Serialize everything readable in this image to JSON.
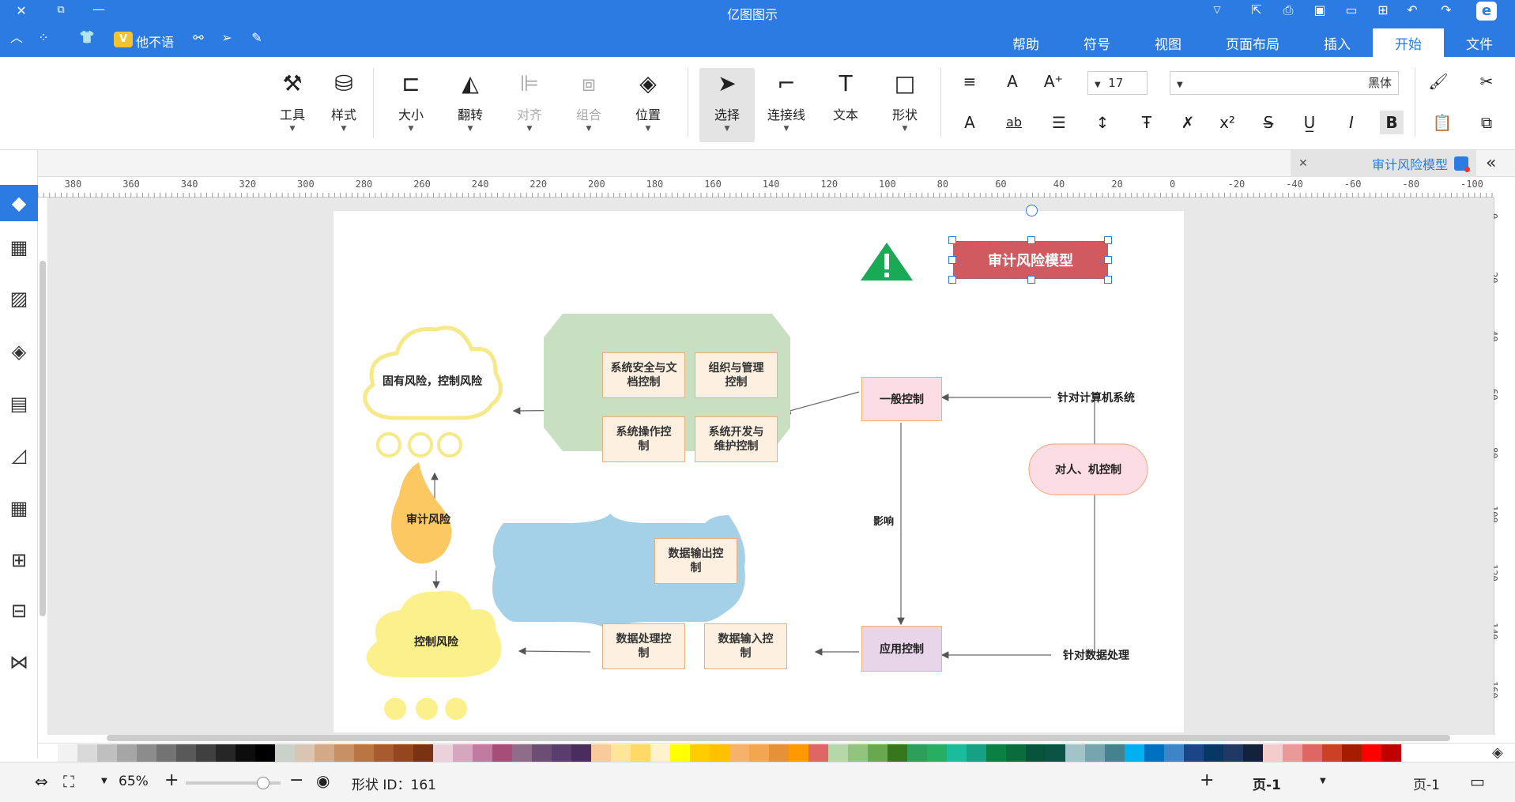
{
  "titlebar": {
    "title": "亿图图示"
  },
  "menubar": {
    "tabs": [
      {
        "label": "文件"
      },
      {
        "label": "开始"
      },
      {
        "label": "插入"
      },
      {
        "label": "页面布局"
      },
      {
        "label": "视图"
      },
      {
        "label": "符号"
      },
      {
        "label": "帮助"
      }
    ],
    "active_tab": "开始",
    "user": "他不语"
  },
  "ribbon": {
    "font_name": "黑体",
    "font_size": "17",
    "tools": {
      "shape": "形状",
      "text": "文本",
      "connector": "连接线",
      "select": "选择",
      "position": "位置",
      "group": "组合",
      "align": "对齐",
      "flip": "翻转",
      "size": "大小",
      "style": "样式",
      "tool": "工具"
    }
  },
  "doc_tab": {
    "title": "审计风险模型"
  },
  "ruler": {
    "h_ticks": [
      "-100",
      "-80",
      "-60",
      "-40",
      "-20",
      "0",
      "20",
      "40",
      "60",
      "80",
      "100",
      "120",
      "140",
      "160",
      "180",
      "200",
      "220",
      "240",
      "260",
      "280",
      "300",
      "320",
      "340",
      "360",
      "380"
    ],
    "v_ticks": [
      "0",
      "20",
      "40",
      "60",
      "80",
      "100",
      "120",
      "140",
      "160"
    ]
  },
  "diagram": {
    "title": "审计风险模型",
    "general_control": "一般控制",
    "app_control": "应用控制",
    "for_computer": "针对计算机系统",
    "for_data": "针对数据处理",
    "people_machine": "对人、机控制",
    "influence": "影响",
    "inherent_risk": "固有风险，控制风险",
    "audit_risk": "审计风险",
    "control_risk": "控制风险",
    "green_items": [
      "组织与管理控制",
      "系统安全与文档控制",
      "系统开发与维护控制",
      "系统操作控制"
    ],
    "blue_items": [
      "数据输出控制",
      "数据输入控制",
      "数据处理控制"
    ]
  },
  "status": {
    "page_label": "页-1",
    "page_tab": "页-1",
    "add": "+",
    "shape_id": "形状 ID：161",
    "zoom": "65%"
  },
  "palette": [
    "#ffffff",
    "#f2f2f2",
    "#d9d9d9",
    "#bfbfbf",
    "#a6a6a6",
    "#8c8c8c",
    "#737373",
    "#595959",
    "#404040",
    "#262626",
    "#0d0d0d",
    "#000000",
    "#c9d1c8",
    "#d9c5b2",
    "#d4a985",
    "#c89165",
    "#b97544",
    "#a85b2f",
    "#94471e",
    "#7a3312",
    "#ead1dc",
    "#d5a6bd",
    "#c27ba0",
    "#a64d79",
    "#8e6c8a",
    "#6b4e71",
    "#5b3c6e",
    "#4a2c5e",
    "#f9cb9c",
    "#ffe599",
    "#ffd966",
    "#fff2cc",
    "#ffff00",
    "#ffcc00",
    "#ffc000",
    "#f6b26b",
    "#f1a64f",
    "#e69138",
    "#ff9900",
    "#e06666",
    "#b6d7a8",
    "#93c47d",
    "#6aa84f",
    "#38761d",
    "#2e9e5b",
    "#27ae60",
    "#1abc9c",
    "#16a085",
    "#0b8043",
    "#0a6b3d",
    "#06543a",
    "#0b5345",
    "#a2c4c9",
    "#76a5af",
    "#45818e",
    "#00b0f0",
    "#0070c0",
    "#3d85c6",
    "#1c4587",
    "#073763",
    "#1f3864",
    "#14213d",
    "#f4cccc",
    "#ea9999",
    "#e06666",
    "#cc4125",
    "#a61c00",
    "#ff0000",
    "#c00000"
  ]
}
